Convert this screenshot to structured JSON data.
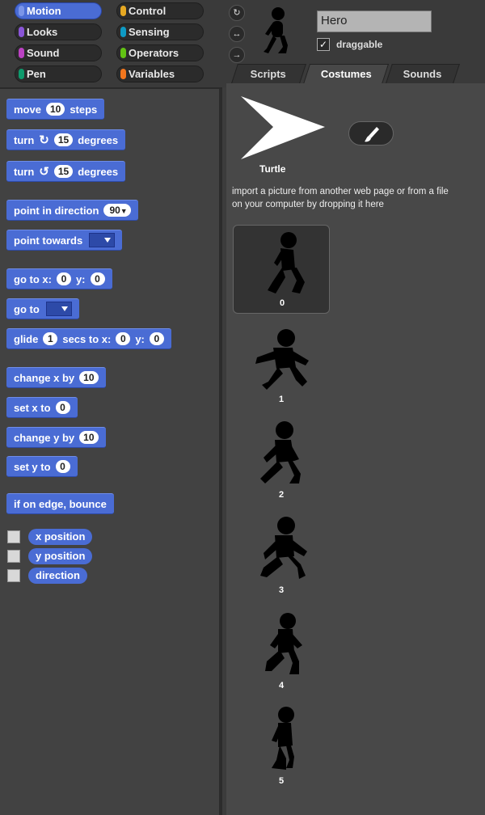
{
  "categories": [
    {
      "label": "Motion",
      "color": "#4a6cd4",
      "selected": true
    },
    {
      "label": "Control",
      "color": "#e6a822"
    },
    {
      "label": "Looks",
      "color": "#8a55d7"
    },
    {
      "label": "Sensing",
      "color": "#0e9ac4"
    },
    {
      "label": "Sound",
      "color": "#bb42c3"
    },
    {
      "label": "Operators",
      "color": "#62c213"
    },
    {
      "label": "Pen",
      "color": "#0e9a6c"
    },
    {
      "label": "Variables",
      "color": "#f3761d"
    }
  ],
  "blocks": {
    "move": {
      "w1": "move",
      "v": "10",
      "w2": "steps"
    },
    "turn_cw": {
      "w1": "turn",
      "v": "15",
      "w2": "degrees"
    },
    "turn_ccw": {
      "w1": "turn",
      "v": "15",
      "w2": "degrees"
    },
    "point_dir": {
      "w1": "point in direction",
      "v": "90"
    },
    "point_towards": {
      "w1": "point towards"
    },
    "go_to_xy": {
      "w1": "go to x:",
      "x": "0",
      "w2": "y:",
      "y": "0"
    },
    "go_to": {
      "w1": "go to"
    },
    "glide": {
      "w1": "glide",
      "s": "1",
      "w2": "secs to x:",
      "x": "0",
      "w3": "y:",
      "y": "0"
    },
    "change_x": {
      "w1": "change x by",
      "v": "10"
    },
    "set_x": {
      "w1": "set x to",
      "v": "0"
    },
    "change_y": {
      "w1": "change y by",
      "v": "10"
    },
    "set_y": {
      "w1": "set y to",
      "v": "0"
    },
    "bounce": {
      "w1": "if on edge, bounce"
    }
  },
  "reporters": [
    "x position",
    "y position",
    "direction"
  ],
  "sprite": {
    "name": "Hero",
    "draggable_label": "draggable",
    "draggable_checked": "✓"
  },
  "tabs": [
    {
      "label": "Scripts"
    },
    {
      "label": "Costumes",
      "active": true
    },
    {
      "label": "Sounds"
    }
  ],
  "costumes_pane": {
    "turtle_label": "Turtle",
    "import_text": "import a picture from another web page or from a file on your computer by dropping it here",
    "costumes": [
      "0",
      "1",
      "2",
      "3",
      "4",
      "5"
    ]
  }
}
